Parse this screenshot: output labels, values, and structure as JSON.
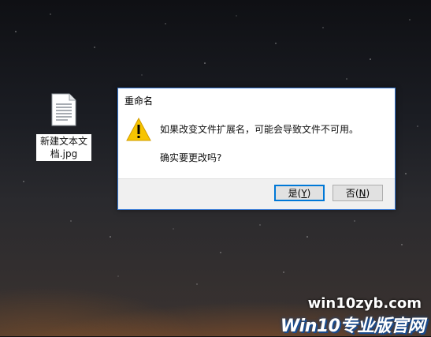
{
  "desktop": {
    "file_label_line1": "新建文本文",
    "file_label_line2": "档.jpg",
    "file_icon": "text-document-icon"
  },
  "dialog": {
    "title": "重命名",
    "icon": "warning-icon",
    "message": "如果改变文件扩展名，可能会导致文件不可用。",
    "question": "确实要更改吗?",
    "yes_label": "是(",
    "yes_hotkey": "Y",
    "yes_close": ")",
    "no_label": "否(",
    "no_hotkey": "N",
    "no_close": ")"
  },
  "watermark": {
    "url": "win10zyb.com",
    "brand": "Win10专业版官网"
  },
  "colors": {
    "dialog_border": "#3a7bd5",
    "default_button_border": "#0078d7",
    "warning_fill": "#f7c400"
  }
}
